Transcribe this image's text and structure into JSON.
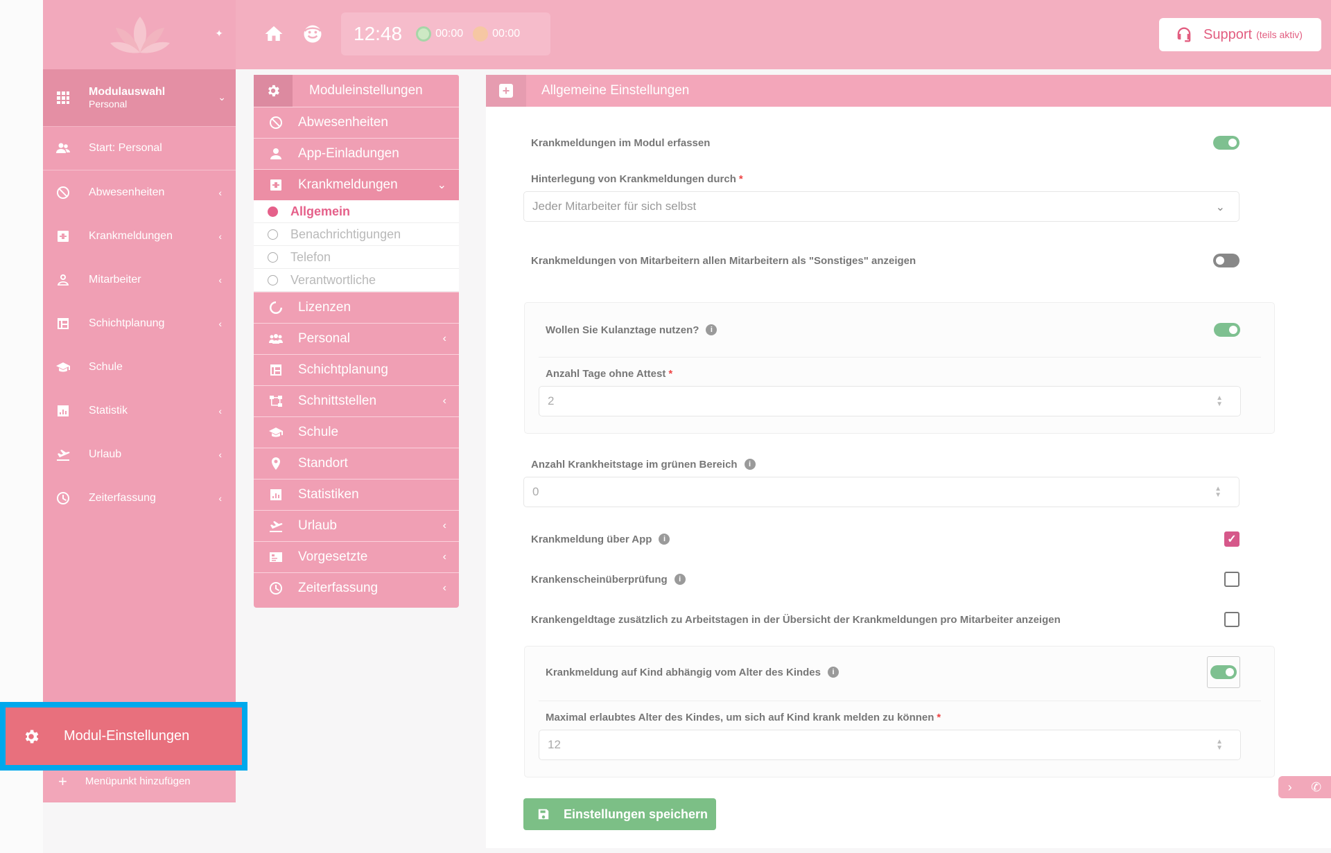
{
  "sidebar": {
    "module_select": {
      "title": "Modulauswahl",
      "subtitle": "Personal"
    },
    "start_label": "Start: Personal",
    "items": [
      {
        "label": "Abwesenheiten",
        "arrow": "‹"
      },
      {
        "label": "Krankmeldungen",
        "arrow": "‹"
      },
      {
        "label": "Mitarbeiter",
        "arrow": "‹"
      },
      {
        "label": "Schichtplanung",
        "arrow": "‹"
      },
      {
        "label": "Schule",
        "arrow": ""
      },
      {
        "label": "Statistik",
        "arrow": "‹"
      },
      {
        "label": "Urlaub",
        "arrow": "‹"
      },
      {
        "label": "Zeiterfassung",
        "arrow": "‹"
      }
    ],
    "modul_settings_label": "Modul-Einstellungen",
    "add_item_label": "Menüpunkt hinzufügen"
  },
  "topbar": {
    "clock": "12:48",
    "timer_green": "00:00",
    "timer_orange": "00:00",
    "support_label": "Support",
    "support_note": "(teils aktiv)"
  },
  "module_menu": {
    "title": "Moduleinstellungen",
    "items_top": [
      {
        "label": "Abwesenheiten"
      },
      {
        "label": "App-Einladungen"
      },
      {
        "label": "Krankmeldungen"
      }
    ],
    "subitems": [
      {
        "label": "Allgemein"
      },
      {
        "label": "Benachrichtigungen"
      },
      {
        "label": "Telefon"
      },
      {
        "label": "Verantwortliche"
      }
    ],
    "items_bottom": [
      {
        "label": "Lizenzen"
      },
      {
        "label": "Personal"
      },
      {
        "label": "Schichtplanung"
      },
      {
        "label": "Schnittstellen"
      },
      {
        "label": "Schule"
      },
      {
        "label": "Standort"
      },
      {
        "label": "Statistiken"
      },
      {
        "label": "Urlaub"
      },
      {
        "label": "Vorgesetzte"
      },
      {
        "label": "Zeiterfassung"
      }
    ]
  },
  "settings": {
    "title": "Allgemeine Einstellungen",
    "record_sick": {
      "label": "Krankmeldungen im Modul erfassen",
      "enabled": true
    },
    "deposit": {
      "label": "Hinterlegung von Krankmeldungen durch",
      "required_mark": "*",
      "value": "Jeder Mitarbeiter für sich selbst"
    },
    "show_other": {
      "label": "Krankmeldungen von Mitarbeitern allen Mitarbeitern als \"Sonstiges\" anzeigen",
      "enabled": false
    },
    "kulanz": {
      "label": "Wollen Sie Kulanztage nutzen?",
      "enabled": true
    },
    "days_no_cert": {
      "label": "Anzahl Tage ohne Attest",
      "required_mark": "*",
      "value": "2"
    },
    "green_days": {
      "label": "Anzahl Krankheitstage im grünen Bereich",
      "value": "0"
    },
    "via_app": {
      "label": "Krankmeldung über App",
      "checked": true
    },
    "cert_check": {
      "label": "Krankenscheinüberprüfung",
      "checked": false
    },
    "sick_pay_days": {
      "label": "Krankengeldtage zusätzlich zu Arbeitstagen in der Übersicht der Krankmeldungen pro Mitarbeiter anzeigen",
      "checked": false
    },
    "child_age": {
      "label": "Krankmeldung auf Kind abhängig vom Alter des Kindes",
      "enabled": true
    },
    "max_child_age": {
      "label": "Maximal erlaubtes Alter des Kindes, um sich auf Kind krank melden zu können",
      "required_mark": "*",
      "value": "12"
    },
    "info_glyph": "i",
    "checkmark_glyph": "✓",
    "save_label": "Einstellungen speichern"
  },
  "colors": {
    "accent": "#f09fb4",
    "highlight": "#00a8ec",
    "save": "#7cbf86",
    "toggle_on": "#7ec090"
  }
}
